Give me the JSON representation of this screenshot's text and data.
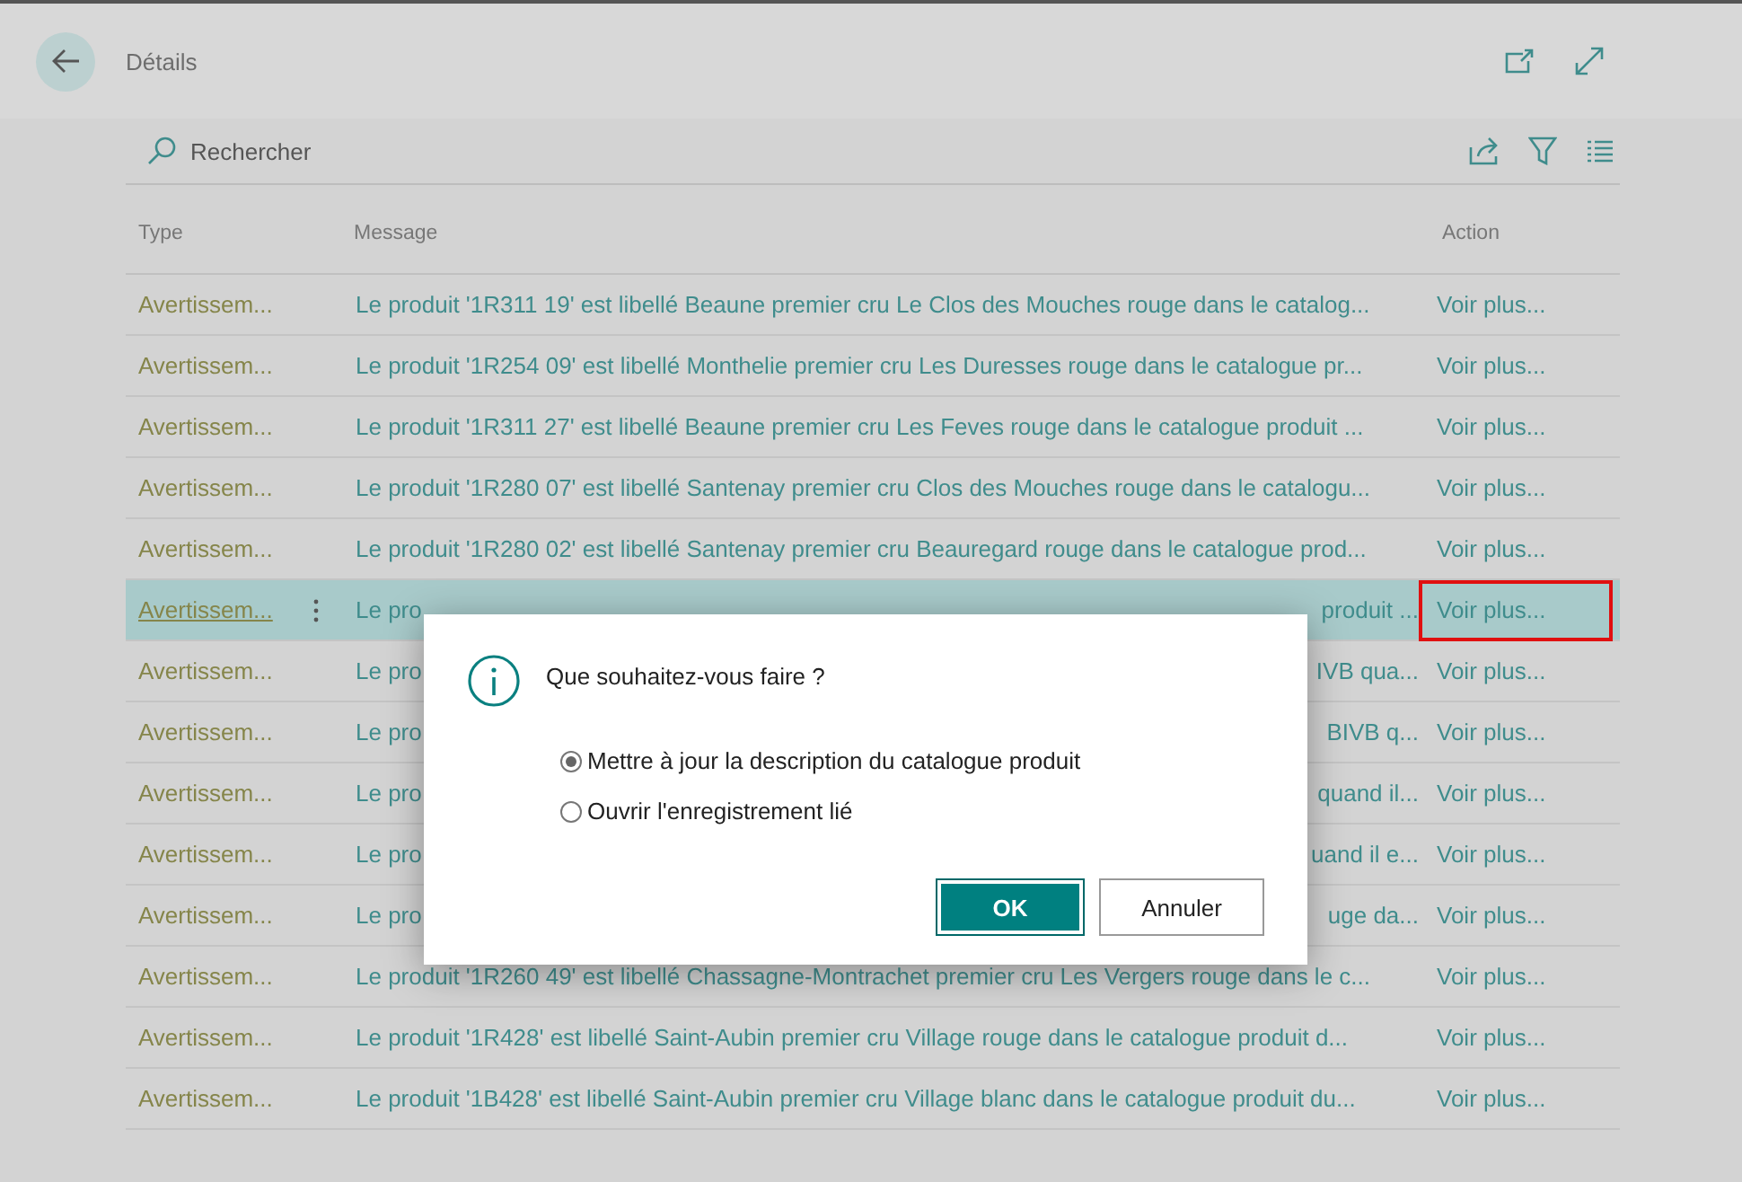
{
  "header": {
    "title": "Détails"
  },
  "search": {
    "placeholder": "Rechercher"
  },
  "table": {
    "columns": [
      "Type",
      "Message",
      "Action"
    ],
    "rows": [
      {
        "type": "Avertissem...",
        "message": "Le produit '1R311 19' est libellé Beaune premier cru Le Clos des Mouches rouge dans le catalog...",
        "action": "Voir plus...",
        "selected": false
      },
      {
        "type": "Avertissem...",
        "message": "Le produit '1R254 09' est libellé Monthelie premier cru Les Duresses rouge dans le catalogue pr...",
        "action": "Voir plus...",
        "selected": false
      },
      {
        "type": "Avertissem...",
        "message": "Le produit '1R311 27' est libellé Beaune premier cru Les Feves rouge dans le catalogue produit ...",
        "action": "Voir plus...",
        "selected": false
      },
      {
        "type": "Avertissem...",
        "message": "Le produit '1R280 07' est libellé Santenay premier cru Clos des Mouches rouge dans le catalogu...",
        "action": "Voir plus...",
        "selected": false
      },
      {
        "type": "Avertissem...",
        "message": "Le produit '1R280 02' est libellé Santenay premier cru Beauregard rouge dans le catalogue prod...",
        "action": "Voir plus...",
        "selected": false
      },
      {
        "type": "Avertissem...",
        "message_start": "Le pro",
        "message_end": "produit ...",
        "action": "Voir plus...",
        "selected": true
      },
      {
        "type": "Avertissem...",
        "message_start": "Le pro",
        "message_end": "IVB qua...",
        "action": "Voir plus...",
        "selected": false
      },
      {
        "type": "Avertissem...",
        "message_start": "Le pro",
        "message_end": "BIVB q...",
        "action": "Voir plus...",
        "selected": false
      },
      {
        "type": "Avertissem...",
        "message_start": "Le pro",
        "message_end": "quand il...",
        "action": "Voir plus...",
        "selected": false
      },
      {
        "type": "Avertissem...",
        "message_start": "Le pro",
        "message_end": "uand il e...",
        "action": "Voir plus...",
        "selected": false
      },
      {
        "type": "Avertissem...",
        "message_start": "Le pro",
        "message_end": "uge da...",
        "action": "Voir plus...",
        "selected": false
      },
      {
        "type": "Avertissem...",
        "message": "Le produit '1R260 49' est libellé Chassagne-Montrachet premier cru Les Vergers rouge dans le c...",
        "action": "Voir plus...",
        "selected": false
      },
      {
        "type": "Avertissem...",
        "message": "Le produit '1R428' est libellé Saint-Aubin premier cru Village rouge dans le catalogue produit d...",
        "action": "Voir plus...",
        "selected": false
      },
      {
        "type": "Avertissem...",
        "message": "Le produit '1B428' est libellé Saint-Aubin premier cru Village blanc dans le catalogue produit du...",
        "action": "Voir plus...",
        "selected": false
      }
    ]
  },
  "dialog": {
    "title": "Que souhaitez-vous faire ?",
    "options": [
      {
        "label": "Mettre à jour la description du catalogue produit",
        "selected": true
      },
      {
        "label": "Ouvrir l'enregistrement lié",
        "selected": false
      }
    ],
    "buttons": [
      {
        "label": "OK",
        "kind": "primary"
      },
      {
        "label": "Annuler",
        "kind": "secondary"
      }
    ]
  }
}
